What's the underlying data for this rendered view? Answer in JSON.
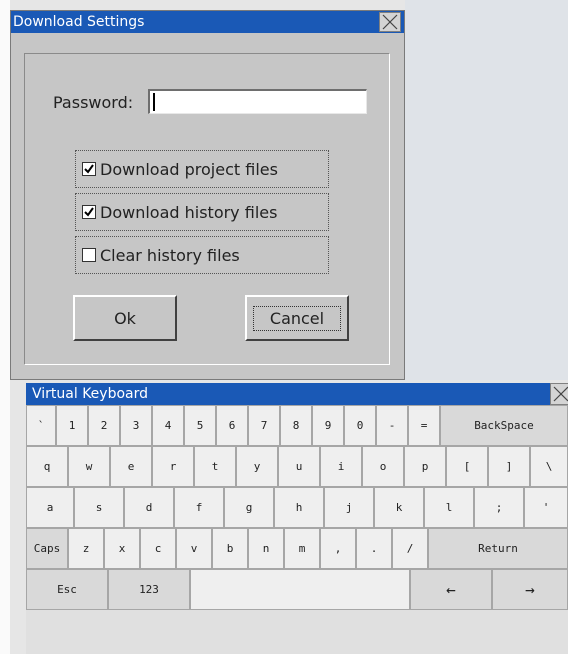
{
  "dialog": {
    "title": "Download Settings",
    "password_label": "Password:",
    "password_value": "",
    "options": [
      {
        "label": "Download project files",
        "checked": true
      },
      {
        "label": "Download history files",
        "checked": true
      },
      {
        "label": "Clear history files",
        "checked": false
      }
    ],
    "ok_label": "Ok",
    "cancel_label": "Cancel"
  },
  "keyboard": {
    "title": "Virtual Keyboard",
    "row1": [
      "`",
      "1",
      "2",
      "3",
      "4",
      "5",
      "6",
      "7",
      "8",
      "9",
      "0",
      "-",
      "=",
      "BackSpace"
    ],
    "row2": [
      "q",
      "w",
      "e",
      "r",
      "t",
      "y",
      "u",
      "i",
      "o",
      "p",
      "[",
      "]",
      "\\"
    ],
    "row3": [
      "a",
      "s",
      "d",
      "f",
      "g",
      "h",
      "j",
      "k",
      "l",
      ";",
      "'"
    ],
    "row4": [
      "Caps",
      "z",
      "x",
      "c",
      "v",
      "b",
      "n",
      "m",
      ",",
      ".",
      "/",
      "Return"
    ],
    "row5": [
      "Esc",
      "123",
      "",
      "←",
      "→"
    ]
  },
  "colors": {
    "titlebar": "#1a59b6",
    "dialog_bg": "#c6c6c6"
  }
}
